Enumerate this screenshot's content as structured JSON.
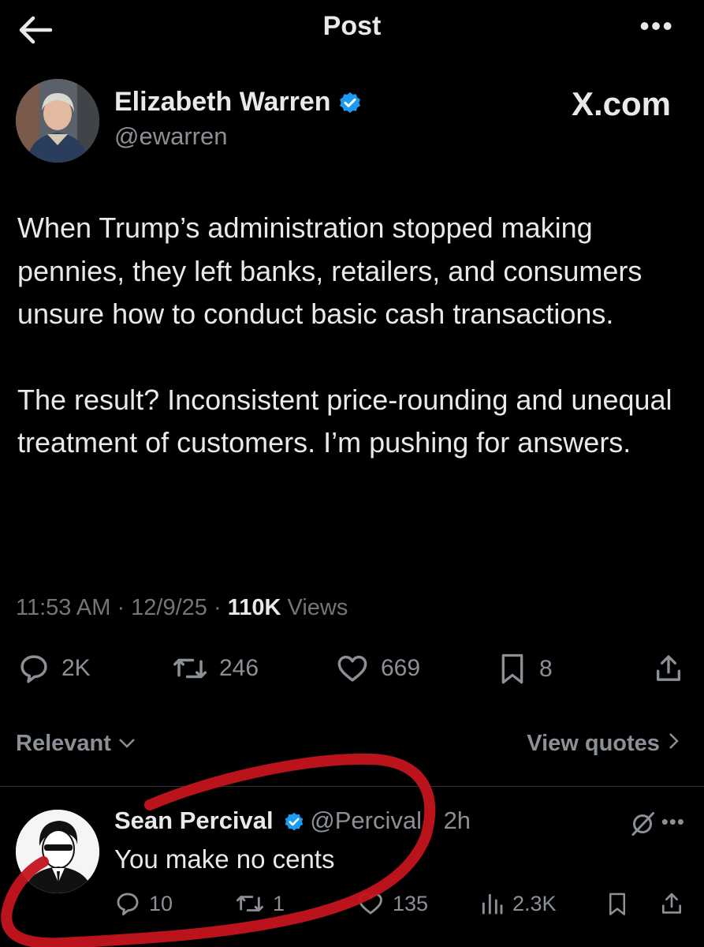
{
  "topbar": {
    "title": "Post",
    "back_icon": "arrow-left-icon",
    "more_icon": "more-horizontal-icon"
  },
  "post": {
    "author": {
      "name": "Elizabeth Warren",
      "handle": "@ewarren",
      "verified": true
    },
    "site_label": "X.com",
    "paragraphs": [
      "When Trump’s administration stopped making pennies, they left banks, retailers, and consumers unsure how to conduct basic cash transactions.",
      "The result? Inconsistent price-rounding and unequal treatment of customers. I’m pushing for answers."
    ],
    "time": "11:53 AM",
    "date": "12/9/25",
    "views_count": "110K",
    "views_label": "Views",
    "stats": {
      "replies": "2K",
      "reposts": "246",
      "likes": "669",
      "bookmarks": "8"
    }
  },
  "filters": {
    "sort_label": "Relevant",
    "view_quotes_label": "View quotes"
  },
  "reply": {
    "name": "Sean Percival",
    "handle": "@Percival",
    "time": "2h",
    "text": "You make no cents",
    "stats": {
      "replies": "10",
      "reposts": "1",
      "likes": "135",
      "views": "2.3K"
    }
  },
  "colors": {
    "background": "#000000",
    "text": "#e7e9ea",
    "muted": "#71767b",
    "verified": "#1d9bf0",
    "annotation": "#c4141c"
  }
}
